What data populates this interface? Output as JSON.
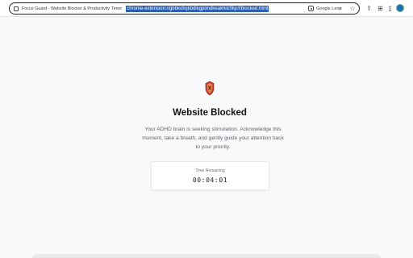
{
  "browser": {
    "tab_title": "Focus Guard - Website Blocker & Productivity Timer",
    "url": "chrome-extension://gbbkofojkbdlkgpdndkeakhilcfikjcf/blocked.html",
    "lens_label": "Google Lens",
    "icons": {
      "page": "page-icon",
      "lens": "google-lens-icon",
      "zoom": "search-icon",
      "bookmark": "star-icon",
      "share": "share-icon",
      "extensions": "puzzle-icon",
      "side_panel": "side-panel-icon",
      "profile": "avatar"
    }
  },
  "blocked_page": {
    "icon": "shield-icon",
    "title": "Website Blocked",
    "message": "Your ADHD brain is seeking stimulation. Acknowledge this moment, take a breath, and gently guide your attention back to your priority.",
    "timer_label": "Time Remaining",
    "timer_value": "00:04:01"
  },
  "colors": {
    "page_background": "#f8f9fa",
    "heading": "#111111",
    "body_text": "#5f6368",
    "url_highlight": "#2a5fb3",
    "shield_red": "#c8382e",
    "shield_orange": "#e8864a"
  }
}
